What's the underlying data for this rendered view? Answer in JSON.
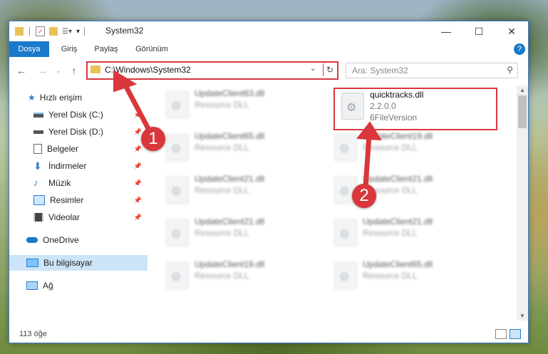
{
  "window": {
    "title": "System32",
    "minimize": "—",
    "maximize": "☐",
    "close": "✕"
  },
  "ribbon": {
    "tabs": [
      "Dosya",
      "Giriş",
      "Paylaş",
      "Görünüm"
    ],
    "help": "?"
  },
  "nav": {
    "address": "C:\\Windows\\System32",
    "search_placeholder": "Ara: System32"
  },
  "sidebar": {
    "quick_access": "Hızlı erişim",
    "items": [
      {
        "label": "Yerel Disk (C:)",
        "icon": "drive-icon",
        "pinned": true
      },
      {
        "label": "Yerel Disk (D:)",
        "icon": "drive-icon",
        "pinned": true
      },
      {
        "label": "Belgeler",
        "icon": "documents-icon",
        "pinned": true
      },
      {
        "label": "İndirmeler",
        "icon": "download-icon",
        "pinned": true
      },
      {
        "label": "Müzik",
        "icon": "music-icon",
        "pinned": true
      },
      {
        "label": "Resimler",
        "icon": "pictures-icon",
        "pinned": true
      },
      {
        "label": "Videolar",
        "icon": "videos-icon",
        "pinned": true
      }
    ],
    "onedrive": "OneDrive",
    "this_pc": "Bu bilgisayar",
    "network": "Ağ"
  },
  "files": [
    {
      "name": "UpdateClient63.dll",
      "type": "Resource DLL"
    },
    {
      "name": "quicktracks.dll",
      "version": "2.2.0.0",
      "desc": "6FileVersion"
    },
    {
      "name": "UpdateClient65.dll",
      "type": "Resource DLL"
    },
    {
      "name": "UpdateClient19.dll",
      "type": "Resource DLL"
    },
    {
      "name": "UpdateClient21.dll",
      "type": "Resource DLL"
    },
    {
      "name": "UpdateClient21.dll",
      "type": "Resource DLL"
    },
    {
      "name": "UpdateClient21.dll",
      "type": "Resource DLL"
    },
    {
      "name": "UpdateClient21.dll",
      "type": "Resource DLL"
    },
    {
      "name": "UpdateClient19.dll",
      "type": "Resource DLL"
    },
    {
      "name": "UpdateClient65.dll",
      "type": "Resource DLL"
    }
  ],
  "status": {
    "count": "113 öğe"
  },
  "annotations": {
    "step1": "1",
    "step2": "2",
    "color": "#d9373b"
  }
}
